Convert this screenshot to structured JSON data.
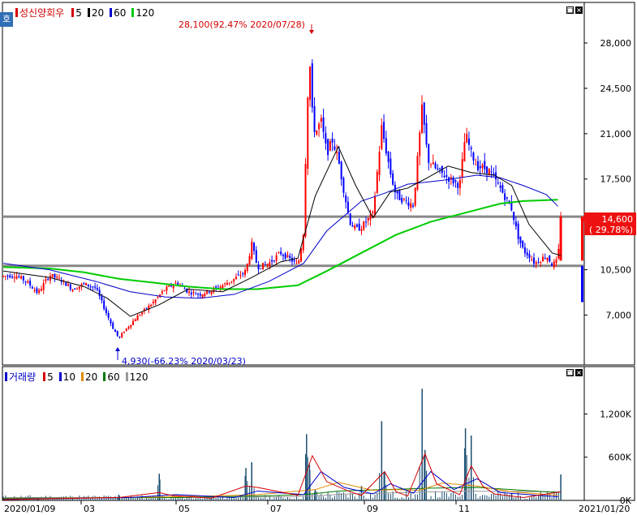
{
  "price_panel": {
    "legend": [
      {
        "label": "성신양회우",
        "color": "#d40000",
        "is_name": true
      },
      {
        "label": "5",
        "color": "#d40000"
      },
      {
        "label": "20",
        "color": "#000000"
      },
      {
        "label": "60",
        "color": "#0000cc"
      },
      {
        "label": "120",
        "color": "#00cc00"
      }
    ],
    "side_tab": "호",
    "current_price_label": "14,600",
    "current_change_label": "( 29.78%)",
    "high_annotation": "28,100(92.47% 2020/07/28)",
    "low_annotation": "4,930(-66.23% 2020/03/23)"
  },
  "volume_panel": {
    "legend": [
      {
        "label": "거래량",
        "color": "#0000cc",
        "is_name": true
      },
      {
        "label": "5",
        "color": "#d40000"
      },
      {
        "label": "10",
        "color": "#0000cc"
      },
      {
        "label": "20",
        "color": "#e08a00"
      },
      {
        "label": "60",
        "color": "#007700"
      },
      {
        "label": "120",
        "color": "#999999"
      }
    ]
  },
  "colors": {
    "up": "#ff0000",
    "down": "#0000ff",
    "ma5": "#d40000",
    "ma20": "#000000",
    "ma60": "#0000cc",
    "ma120": "#00cc00",
    "hline": "#888888"
  },
  "chart_data": {
    "type": "candlestick",
    "title": "성신양회우",
    "x_tick_labels": [
      "2020/01/09",
      "03",
      "05",
      "07",
      "09",
      "11",
      "2021/01/20"
    ],
    "price_axis": {
      "ticks": [
        7000,
        10500,
        14000,
        17500,
        21000,
        24500,
        28000
      ],
      "tick_labels": [
        "7,000",
        "10,500",
        "",
        "17,500",
        "21,000",
        "24,500",
        "28,000"
      ],
      "range": [
        3150,
        31130
      ]
    },
    "volume_axis": {
      "ticks": [
        0,
        600000,
        1200000
      ],
      "tick_labels": [
        "0K",
        "600K",
        "1,200K"
      ],
      "range": [
        0,
        1700000
      ]
    },
    "horizontal_lines": [
      14600,
      10800
    ],
    "series_points": [
      {
        "x": 0.0,
        "p": 10000
      },
      {
        "x": 0.02,
        "p": 10100
      },
      {
        "x": 0.04,
        "p": 9600
      },
      {
        "x": 0.06,
        "p": 8700
      },
      {
        "x": 0.08,
        "p": 10100
      },
      {
        "x": 0.1,
        "p": 9700
      },
      {
        "x": 0.12,
        "p": 9000
      },
      {
        "x": 0.14,
        "p": 9400
      },
      {
        "x": 0.16,
        "p": 9100
      },
      {
        "x": 0.18,
        "p": 7000
      },
      {
        "x": 0.19,
        "p": 6000
      },
      {
        "x": 0.2,
        "p": 5200
      },
      {
        "x": 0.21,
        "p": 5800
      },
      {
        "x": 0.23,
        "p": 6800
      },
      {
        "x": 0.26,
        "p": 8000
      },
      {
        "x": 0.28,
        "p": 9000
      },
      {
        "x": 0.3,
        "p": 9500
      },
      {
        "x": 0.32,
        "p": 8800
      },
      {
        "x": 0.34,
        "p": 8600
      },
      {
        "x": 0.36,
        "p": 8900
      },
      {
        "x": 0.38,
        "p": 9300
      },
      {
        "x": 0.4,
        "p": 9800
      },
      {
        "x": 0.42,
        "p": 10400
      },
      {
        "x": 0.43,
        "p": 12500
      },
      {
        "x": 0.44,
        "p": 10700
      },
      {
        "x": 0.46,
        "p": 11000
      },
      {
        "x": 0.48,
        "p": 11800
      },
      {
        "x": 0.5,
        "p": 11200
      },
      {
        "x": 0.51,
        "p": 10800
      },
      {
        "x": 0.52,
        "p": 13500
      },
      {
        "x": 0.525,
        "p": 22000
      },
      {
        "x": 0.53,
        "p": 27000
      },
      {
        "x": 0.535,
        "p": 22500
      },
      {
        "x": 0.54,
        "p": 21000
      },
      {
        "x": 0.55,
        "p": 22000
      },
      {
        "x": 0.56,
        "p": 19500
      },
      {
        "x": 0.57,
        "p": 20500
      },
      {
        "x": 0.58,
        "p": 19000
      },
      {
        "x": 0.59,
        "p": 16500
      },
      {
        "x": 0.6,
        "p": 14200
      },
      {
        "x": 0.61,
        "p": 13600
      },
      {
        "x": 0.62,
        "p": 13800
      },
      {
        "x": 0.64,
        "p": 14800
      },
      {
        "x": 0.655,
        "p": 21500
      },
      {
        "x": 0.67,
        "p": 18000
      },
      {
        "x": 0.68,
        "p": 16200
      },
      {
        "x": 0.7,
        "p": 15700
      },
      {
        "x": 0.71,
        "p": 15500
      },
      {
        "x": 0.725,
        "p": 23000
      },
      {
        "x": 0.735,
        "p": 19000
      },
      {
        "x": 0.75,
        "p": 18200
      },
      {
        "x": 0.77,
        "p": 17600
      },
      {
        "x": 0.79,
        "p": 17000
      },
      {
        "x": 0.8,
        "p": 21000
      },
      {
        "x": 0.81,
        "p": 19500
      },
      {
        "x": 0.82,
        "p": 18500
      },
      {
        "x": 0.84,
        "p": 18200
      },
      {
        "x": 0.86,
        "p": 16800
      },
      {
        "x": 0.87,
        "p": 16000
      },
      {
        "x": 0.88,
        "p": 15200
      },
      {
        "x": 0.89,
        "p": 13200
      },
      {
        "x": 0.9,
        "p": 12000
      },
      {
        "x": 0.91,
        "p": 11600
      },
      {
        "x": 0.92,
        "p": 11000
      },
      {
        "x": 0.94,
        "p": 11600
      },
      {
        "x": 0.95,
        "p": 10900
      },
      {
        "x": 0.96,
        "p": 11200
      },
      {
        "x": 0.965,
        "p": 14600
      }
    ],
    "ma5_points": [
      [
        0.0,
        10000
      ],
      [
        0.06,
        9400
      ],
      [
        0.12,
        9300
      ],
      [
        0.18,
        7500
      ],
      [
        0.2,
        5800
      ],
      [
        0.24,
        6900
      ],
      [
        0.3,
        9100
      ],
      [
        0.36,
        8700
      ],
      [
        0.42,
        10200
      ],
      [
        0.46,
        11000
      ],
      [
        0.5,
        11200
      ],
      [
        0.52,
        13000
      ],
      [
        0.535,
        23000
      ],
      [
        0.56,
        20500
      ],
      [
        0.59,
        17000
      ],
      [
        0.62,
        14000
      ],
      [
        0.655,
        19000
      ],
      [
        0.68,
        16800
      ],
      [
        0.71,
        15700
      ],
      [
        0.725,
        20000
      ],
      [
        0.76,
        18000
      ],
      [
        0.8,
        19500
      ],
      [
        0.83,
        18500
      ],
      [
        0.87,
        16000
      ],
      [
        0.9,
        12200
      ],
      [
        0.93,
        11200
      ],
      [
        0.96,
        11300
      ]
    ],
    "ma20_points": [
      [
        0.0,
        10400
      ],
      [
        0.08,
        9900
      ],
      [
        0.14,
        9200
      ],
      [
        0.18,
        8300
      ],
      [
        0.22,
        6900
      ],
      [
        0.27,
        7800
      ],
      [
        0.32,
        9000
      ],
      [
        0.38,
        8800
      ],
      [
        0.43,
        9900
      ],
      [
        0.48,
        11100
      ],
      [
        0.51,
        11400
      ],
      [
        0.54,
        16200
      ],
      [
        0.58,
        20000
      ],
      [
        0.61,
        17000
      ],
      [
        0.64,
        14500
      ],
      [
        0.67,
        16500
      ],
      [
        0.7,
        16800
      ],
      [
        0.73,
        17500
      ],
      [
        0.77,
        18500
      ],
      [
        0.81,
        18000
      ],
      [
        0.85,
        17800
      ],
      [
        0.88,
        17000
      ],
      [
        0.91,
        14000
      ],
      [
        0.95,
        11800
      ],
      [
        0.965,
        11600
      ]
    ],
    "ma60_points": [
      [
        0.0,
        11000
      ],
      [
        0.08,
        10500
      ],
      [
        0.16,
        9600
      ],
      [
        0.22,
        8800
      ],
      [
        0.28,
        8400
      ],
      [
        0.34,
        8300
      ],
      [
        0.4,
        8600
      ],
      [
        0.46,
        9600
      ],
      [
        0.52,
        11000
      ],
      [
        0.56,
        13500
      ],
      [
        0.62,
        15800
      ],
      [
        0.66,
        16400
      ],
      [
        0.7,
        17100
      ],
      [
        0.76,
        17400
      ],
      [
        0.82,
        17800
      ],
      [
        0.86,
        17600
      ],
      [
        0.9,
        17000
      ],
      [
        0.94,
        16300
      ],
      [
        0.96,
        15400
      ]
    ],
    "ma120_points": [
      [
        0.0,
        10700
      ],
      [
        0.08,
        10600
      ],
      [
        0.14,
        10300
      ],
      [
        0.2,
        9800
      ],
      [
        0.26,
        9500
      ],
      [
        0.32,
        9200
      ],
      [
        0.38,
        9000
      ],
      [
        0.44,
        9000
      ],
      [
        0.51,
        9300
      ],
      [
        0.56,
        10400
      ],
      [
        0.62,
        11800
      ],
      [
        0.68,
        13200
      ],
      [
        0.74,
        14200
      ],
      [
        0.8,
        14900
      ],
      [
        0.86,
        15600
      ],
      [
        0.9,
        15800
      ],
      [
        0.96,
        15900
      ]
    ],
    "volume_spikes": [
      [
        0.01,
        10000
      ],
      [
        0.06,
        30000
      ],
      [
        0.12,
        50000
      ],
      [
        0.2,
        80000
      ],
      [
        0.27,
        370000
      ],
      [
        0.36,
        30000
      ],
      [
        0.42,
        450000
      ],
      [
        0.43,
        530000
      ],
      [
        0.525,
        920000
      ],
      [
        0.53,
        500000
      ],
      [
        0.54,
        150000
      ],
      [
        0.62,
        200000
      ],
      [
        0.655,
        1100000
      ],
      [
        0.66,
        400000
      ],
      [
        0.725,
        1550000
      ],
      [
        0.73,
        700000
      ],
      [
        0.8,
        1000000
      ],
      [
        0.81,
        900000
      ],
      [
        0.88,
        100000
      ],
      [
        0.93,
        60000
      ],
      [
        0.965,
        360000
      ]
    ],
    "vol_ma5_points": [
      [
        0.0,
        10000
      ],
      [
        0.2,
        40000
      ],
      [
        0.27,
        110000
      ],
      [
        0.29,
        70000
      ],
      [
        0.36,
        30000
      ],
      [
        0.42,
        200000
      ],
      [
        0.44,
        180000
      ],
      [
        0.51,
        70000
      ],
      [
        0.535,
        620000
      ],
      [
        0.56,
        260000
      ],
      [
        0.6,
        120000
      ],
      [
        0.62,
        70000
      ],
      [
        0.66,
        400000
      ],
      [
        0.68,
        120000
      ],
      [
        0.7,
        60000
      ],
      [
        0.73,
        650000
      ],
      [
        0.75,
        230000
      ],
      [
        0.79,
        80000
      ],
      [
        0.81,
        480000
      ],
      [
        0.83,
        200000
      ],
      [
        0.85,
        90000
      ],
      [
        0.9,
        40000
      ],
      [
        0.965,
        120000
      ]
    ],
    "vol_ma10_points": [
      [
        0.0,
        15000
      ],
      [
        0.22,
        40000
      ],
      [
        0.3,
        80000
      ],
      [
        0.4,
        40000
      ],
      [
        0.44,
        130000
      ],
      [
        0.52,
        80000
      ],
      [
        0.55,
        400000
      ],
      [
        0.59,
        180000
      ],
      [
        0.64,
        90000
      ],
      [
        0.67,
        230000
      ],
      [
        0.71,
        100000
      ],
      [
        0.74,
        400000
      ],
      [
        0.78,
        150000
      ],
      [
        0.82,
        300000
      ],
      [
        0.86,
        110000
      ],
      [
        0.96,
        50000
      ]
    ],
    "vol_ma20_points": [
      [
        0.0,
        20000
      ],
      [
        0.3,
        50000
      ],
      [
        0.44,
        80000
      ],
      [
        0.54,
        150000
      ],
      [
        0.58,
        250000
      ],
      [
        0.64,
        140000
      ],
      [
        0.68,
        150000
      ],
      [
        0.72,
        140000
      ],
      [
        0.76,
        240000
      ],
      [
        0.82,
        200000
      ],
      [
        0.88,
        120000
      ],
      [
        0.96,
        70000
      ]
    ],
    "vol_ma60_points": [
      [
        0.0,
        30000
      ],
      [
        0.3,
        40000
      ],
      [
        0.44,
        60000
      ],
      [
        0.52,
        80000
      ],
      [
        0.58,
        130000
      ],
      [
        0.66,
        150000
      ],
      [
        0.74,
        170000
      ],
      [
        0.82,
        180000
      ],
      [
        0.9,
        140000
      ],
      [
        0.96,
        110000
      ]
    ],
    "vol_ma120_points": [
      [
        0.0,
        40000
      ],
      [
        0.3,
        40000
      ],
      [
        0.5,
        50000
      ],
      [
        0.6,
        90000
      ],
      [
        0.7,
        110000
      ],
      [
        0.8,
        130000
      ],
      [
        0.96,
        120000
      ]
    ]
  }
}
